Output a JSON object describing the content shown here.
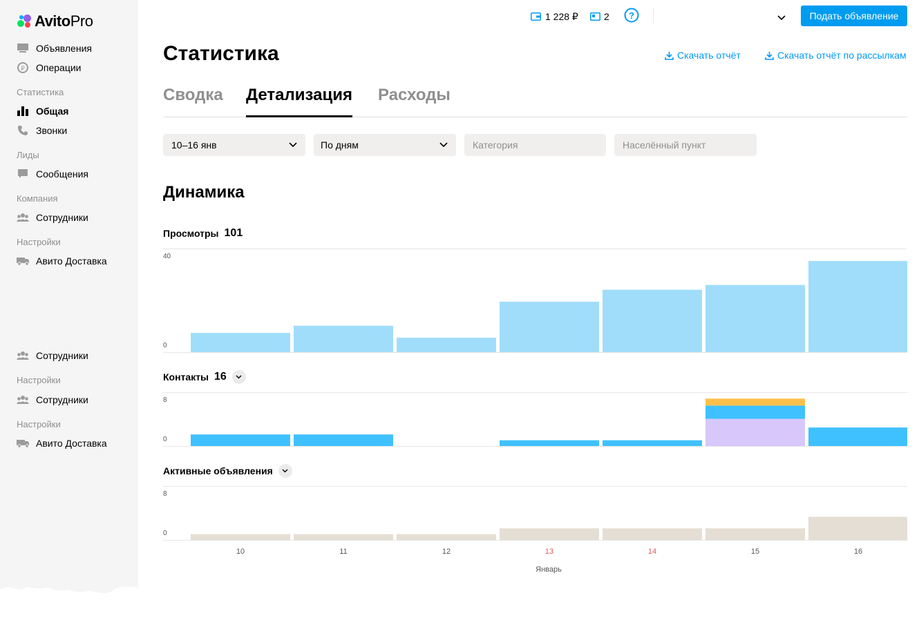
{
  "sidebar": {
    "logo_avito": "Avito",
    "logo_pro": "Pro",
    "items": [
      {
        "label": "Объявления"
      },
      {
        "label": "Операции"
      },
      {
        "label": "Общая"
      },
      {
        "label": "Звонки"
      },
      {
        "label": "Сообщения"
      },
      {
        "label": "Сотрудники"
      },
      {
        "label": "Авито Доставка"
      },
      {
        "label": "Сотрудники"
      },
      {
        "label": "Сотрудники"
      },
      {
        "label": "Авито Доставка"
      }
    ],
    "headers": [
      "Статистика",
      "Лиды",
      "Компания",
      "Настройки",
      "Настройки",
      "Настройки"
    ]
  },
  "topbar": {
    "wallet": "1 228 ₽",
    "listings_count": "2",
    "post_button": "Подать объявление"
  },
  "page": {
    "title": "Статистика",
    "download_report": "Скачать отчёт",
    "download_mailing_report": "Скачать отчёт по рассылкам",
    "tabs": [
      {
        "label": "Сводка",
        "active": false
      },
      {
        "label": "Детализация",
        "active": true
      },
      {
        "label": "Расходы",
        "active": false
      }
    ],
    "filters": {
      "period": "10–16 янв",
      "grouping": "По дням",
      "category_placeholder": "Категория",
      "city_placeholder": "Населённый пункт"
    },
    "section_title": "Динамика"
  },
  "chart_data": [
    {
      "type": "bar",
      "title": "Просмотры",
      "total": "101",
      "categories": [
        "10",
        "11",
        "12",
        "13",
        "14",
        "15",
        "16"
      ],
      "values": [
        8,
        11,
        6,
        21,
        26,
        28,
        38
      ],
      "ylim": [
        0,
        40
      ],
      "y_ticks": [
        "40",
        "0"
      ],
      "color": "#a0ddfb"
    },
    {
      "type": "bar",
      "title": "Контакты",
      "total": "16",
      "categories": [
        "10",
        "11",
        "12",
        "13",
        "14",
        "15",
        "16"
      ],
      "stacked": true,
      "series": [
        {
          "values": [
            0,
            0,
            0,
            0,
            0,
            4.7,
            0
          ],
          "color": "#d8c7fb"
        },
        {
          "values": [
            2,
            2,
            0,
            1,
            1,
            2.3,
            3.2
          ],
          "color": "#40c1ff"
        },
        {
          "values": [
            0,
            0,
            0,
            0,
            0,
            1.2,
            0
          ],
          "color": "#ffbf4b"
        }
      ],
      "ylim": [
        0,
        8
      ],
      "y_ticks": [
        "8",
        "0"
      ]
    },
    {
      "type": "bar",
      "title": "Активные объявления",
      "categories": [
        "10",
        "11",
        "12",
        "13",
        "14",
        "15",
        "16"
      ],
      "values": [
        1,
        1,
        1,
        2,
        2,
        2,
        4
      ],
      "ylim": [
        0,
        8
      ],
      "y_ticks": [
        "8",
        "0"
      ],
      "color": "#e4ded4"
    }
  ],
  "x_axis": {
    "labels": [
      "10",
      "11",
      "12",
      "13",
      "14",
      "15",
      "16"
    ],
    "weekend": [
      "13",
      "14"
    ],
    "month": "Январь"
  },
  "colors": {
    "accent": "#009cf0",
    "link": "#0099f7",
    "weekend": "#e0585a"
  }
}
